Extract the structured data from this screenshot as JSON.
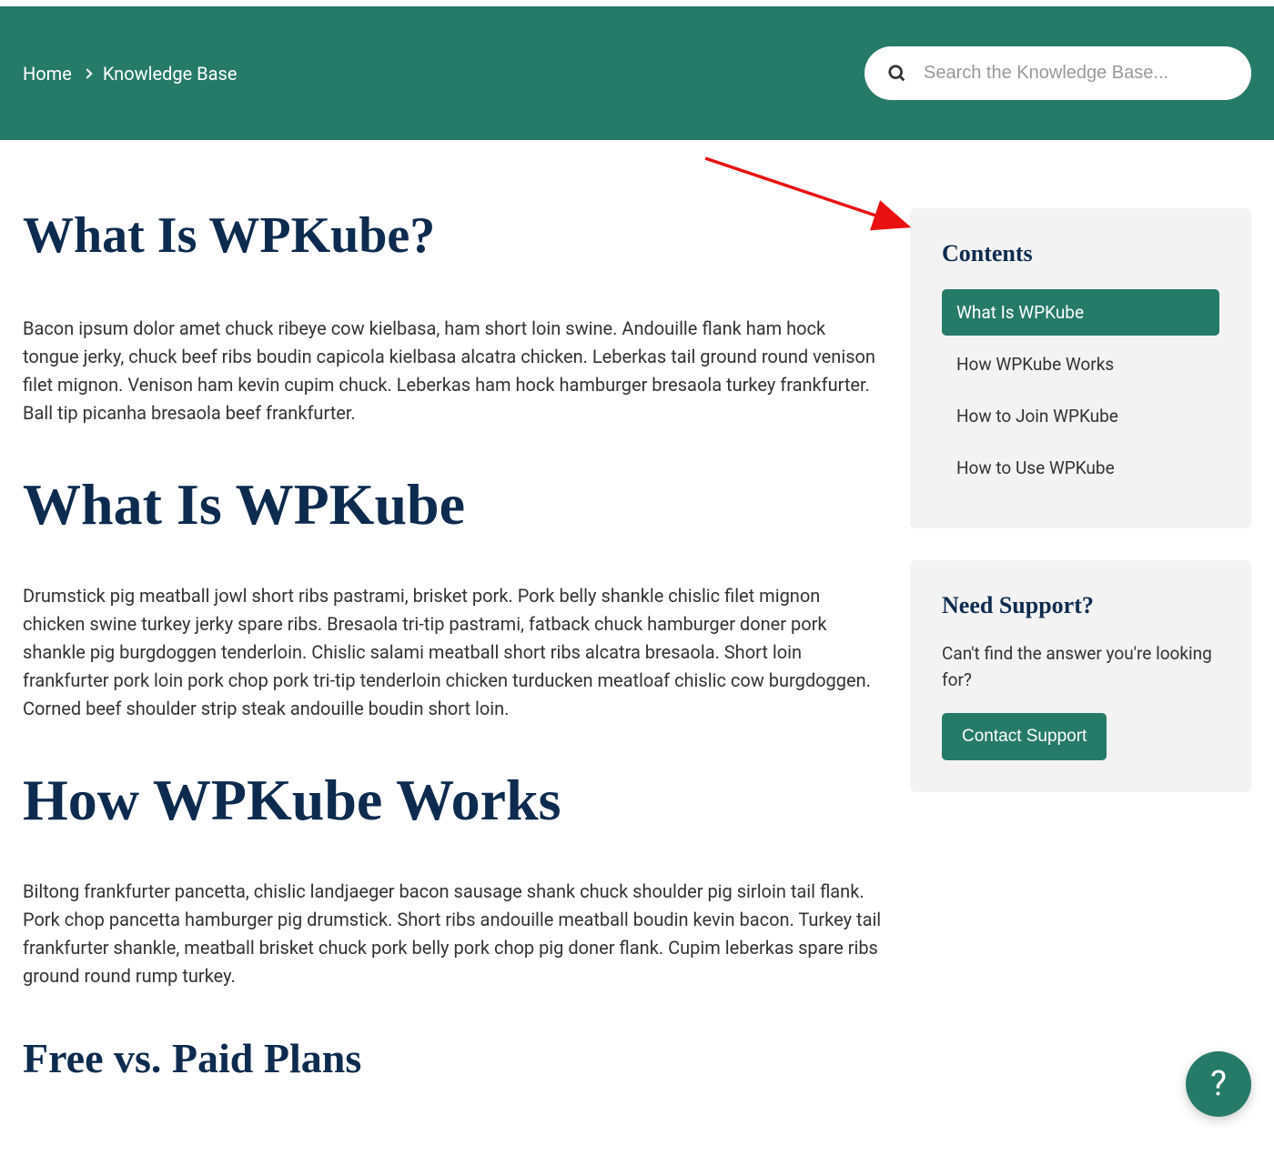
{
  "breadcrumb": {
    "home": "Home",
    "current": "Knowledge Base"
  },
  "search": {
    "placeholder": "Search the Knowledge Base..."
  },
  "page": {
    "title": "What Is WPKube?",
    "intro": "Bacon ipsum dolor amet chuck ribeye cow kielbasa, ham short loin swine. Andouille flank ham hock tongue jerky, chuck beef ribs boudin capicola kielbasa alcatra chicken. Leberkas tail ground round venison filet mignon. Venison ham kevin cupim chuck. Leberkas ham hock hamburger bresaola turkey frankfurter. Ball tip picanha bresaola beef frankfurter.",
    "sections": {
      "s1": {
        "heading": "What Is WPKube",
        "body": "Drumstick pig meatball jowl short ribs pastrami, brisket pork. Pork belly shankle chislic filet mignon chicken swine turkey jerky spare ribs. Bresaola tri-tip pastrami, fatback chuck hamburger doner pork shankle pig burgdoggen tenderloin. Chislic salami meatball short ribs alcatra bresaola. Short loin frankfurter pork loin pork chop pork tri-tip tenderloin chicken turducken meatloaf chislic cow burgdoggen. Corned beef shoulder strip steak andouille boudin short loin."
      },
      "s2": {
        "heading": "How WPKube Works",
        "body": "Biltong frankfurter pancetta, chislic landjaeger bacon sausage shank chuck shoulder pig sirloin tail flank. Pork chop pancetta hamburger pig drumstick. Short ribs andouille meatball boudin kevin bacon. Turkey tail frankfurter shankle, meatball brisket chuck pork belly pork chop pig doner flank. Cupim leberkas spare ribs ground round rump turkey."
      },
      "s3": {
        "heading": "Free vs. Paid Plans"
      }
    }
  },
  "toc": {
    "heading": "Contents",
    "items": [
      {
        "label": "What Is WPKube",
        "active": true
      },
      {
        "label": "How WPKube Works",
        "active": false
      },
      {
        "label": "How to Join WPKube",
        "active": false
      },
      {
        "label": "How to Use WPKube",
        "active": false
      }
    ]
  },
  "support": {
    "heading": "Need Support?",
    "text": "Can't find the answer you're looking for?",
    "button": "Contact Support"
  },
  "fab": {
    "label": "?"
  }
}
